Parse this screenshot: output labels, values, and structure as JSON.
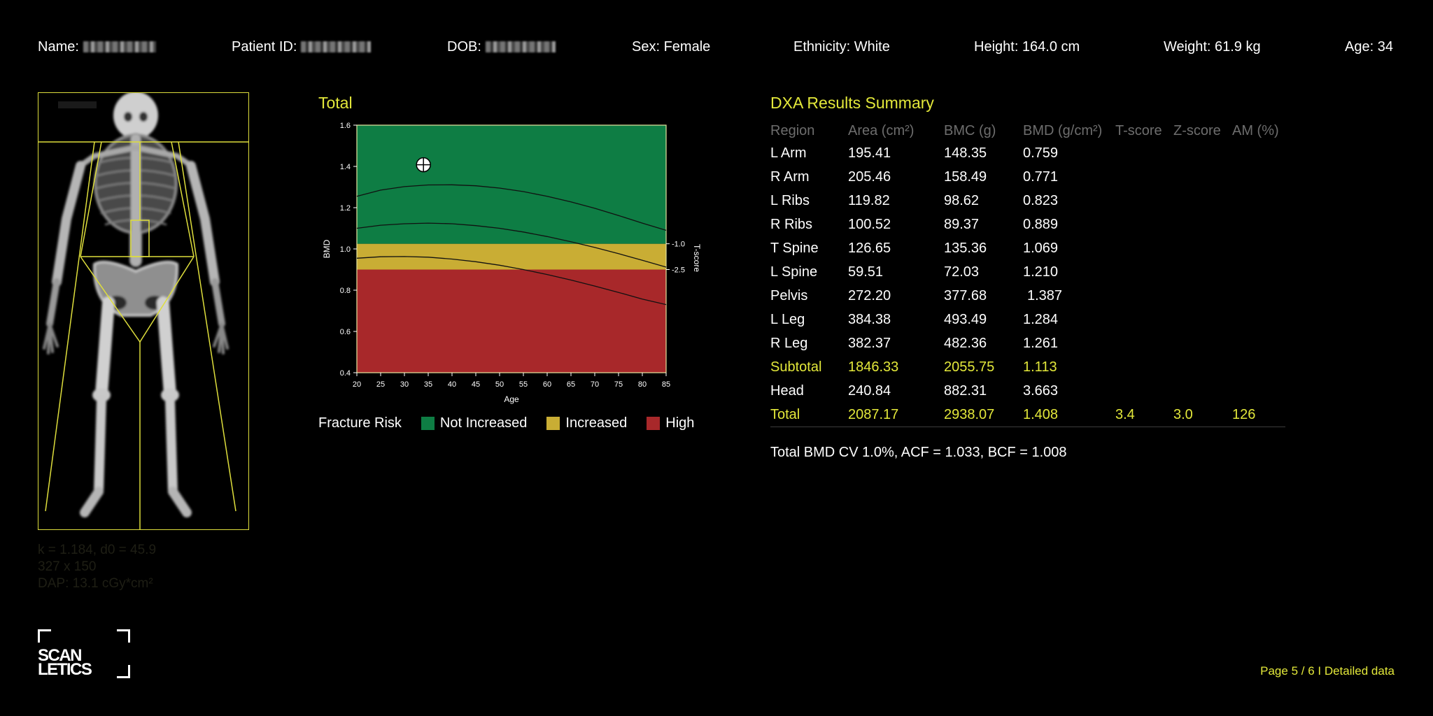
{
  "header": {
    "name_label": "Name:",
    "patient_id_label": "Patient ID:",
    "dob_label": "DOB:",
    "sex": "Sex: Female",
    "ethnicity": "Ethnicity: White",
    "height": "Height: 164.0 cm",
    "weight": "Weight: 61.9 kg",
    "age": "Age: 34"
  },
  "scan_meta": {
    "line1": "k = 1.184, d0 = 45.9",
    "line2": "327 x 150",
    "line3": "DAP: 13.1 cGy*cm²"
  },
  "chart_data": {
    "type": "line",
    "title": "Total",
    "xlabel": "Age",
    "ylabel": "BMD",
    "y2label": "T-score",
    "xlim": [
      20,
      85
    ],
    "ylim": [
      0.4,
      1.6
    ],
    "x_ticks": [
      20,
      25,
      30,
      35,
      40,
      45,
      50,
      55,
      60,
      65,
      70,
      75,
      80,
      85
    ],
    "y_ticks": [
      "0.4",
      "0.6",
      "0.8",
      "1.0",
      "1.2",
      "1.4",
      "1.6"
    ],
    "t_score_ticks": [
      {
        "label": "-1.0",
        "bmd": 1.025
      },
      {
        "label": "-2.5",
        "bmd": 0.9
      }
    ],
    "zones": [
      {
        "name": "High",
        "from": 0.4,
        "to": 0.9,
        "color": "#a8282a"
      },
      {
        "name": "Increased",
        "from": 0.9,
        "to": 1.025,
        "color": "#c9ad34"
      },
      {
        "name": "Not Increased",
        "from": 1.025,
        "to": 1.6,
        "color": "#0e7d44"
      }
    ],
    "series": [
      {
        "x": [
          20,
          25,
          30,
          35,
          40,
          45,
          50,
          55,
          60,
          65,
          70,
          75,
          80,
          85
        ],
        "y": [
          1.255,
          1.285,
          1.302,
          1.31,
          1.311,
          1.306,
          1.295,
          1.278,
          1.255,
          1.228,
          1.197,
          1.162,
          1.125,
          1.09
        ]
      },
      {
        "x": [
          20,
          25,
          30,
          35,
          40,
          45,
          50,
          55,
          60,
          65,
          70,
          75,
          80,
          85
        ],
        "y": [
          1.1,
          1.115,
          1.122,
          1.125,
          1.122,
          1.113,
          1.1,
          1.082,
          1.06,
          1.035,
          1.007,
          0.977,
          0.945,
          0.912
        ]
      },
      {
        "x": [
          20,
          25,
          30,
          35,
          40,
          45,
          50,
          55,
          60,
          65,
          70,
          75,
          80,
          85
        ],
        "y": [
          0.955,
          0.962,
          0.963,
          0.96,
          0.951,
          0.938,
          0.921,
          0.9,
          0.876,
          0.849,
          0.82,
          0.789,
          0.757,
          0.73
        ]
      }
    ],
    "patient_point": {
      "age": 34,
      "bmd": 1.408
    }
  },
  "legend": {
    "title": "Fracture Risk",
    "items": [
      {
        "label": "Not Increased",
        "color": "#0e7d44"
      },
      {
        "label": "Increased",
        "color": "#c9ad34"
      },
      {
        "label": "High",
        "color": "#a8282a"
      }
    ]
  },
  "summary": {
    "title": "DXA Results Summary",
    "columns": [
      "Region",
      "Area (cm²)",
      "BMC (g)",
      "BMD (g/cm²)",
      "T-score",
      "Z-score",
      "AM (%)"
    ],
    "rows": [
      [
        "L Arm",
        "195.41",
        "148.35",
        "0.759",
        "",
        "",
        ""
      ],
      [
        "R Arm",
        "205.46",
        "158.49",
        "0.771",
        "",
        "",
        ""
      ],
      [
        "L Ribs",
        "119.82",
        "98.62",
        "0.823",
        "",
        "",
        ""
      ],
      [
        "R Ribs",
        "100.52",
        "89.37",
        "0.889",
        "",
        "",
        ""
      ],
      [
        "T Spine",
        "126.65",
        "135.36",
        "1.069",
        "",
        "",
        ""
      ],
      [
        "L Spine",
        "59.51",
        "72.03",
        "1.210",
        "",
        "",
        ""
      ],
      [
        "Pelvis",
        "272.20",
        "377.68",
        " 1.387",
        "",
        "",
        ""
      ],
      [
        "L Leg",
        "384.38",
        "493.49",
        "1.284",
        "",
        "",
        ""
      ],
      [
        "R Leg",
        "382.37",
        "482.36",
        "1.261",
        "",
        "",
        ""
      ],
      [
        "Subtotal",
        "1846.33",
        "2055.75",
        "1.113",
        "",
        "",
        ""
      ],
      [
        "Head",
        "240.84",
        "882.31",
        "3.663",
        "",
        "",
        ""
      ],
      [
        "Total",
        "2087.17",
        "2938.07",
        "1.408",
        "3.4",
        "3.0",
        "126"
      ]
    ],
    "highlight_rows": [
      "Subtotal",
      "Total"
    ],
    "note": "Total BMD CV 1.0%, ACF = 1.033, BCF = 1.008"
  },
  "logo": {
    "line1": "SCAN",
    "line2": "LETICS"
  },
  "footer": "Page 5 / 6 I Detailed data",
  "accent_color": "#e3e83a"
}
